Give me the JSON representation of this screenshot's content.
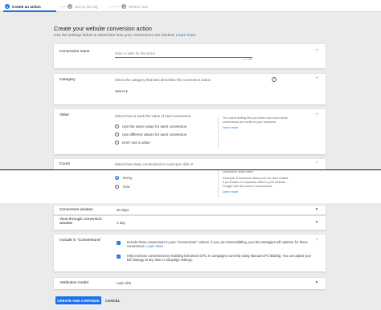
{
  "stepper": {
    "steps": [
      {
        "num": "1",
        "label": "Create an action"
      },
      {
        "num": "2",
        "label": "Set up the tag"
      },
      {
        "num": "3",
        "label": "What's next"
      }
    ]
  },
  "header": {
    "title": "Create your website conversion action",
    "subtitle": "Use the settings below to determine how your conversions are tracked.",
    "learn_more": "Learn more"
  },
  "conversion_name": {
    "label": "Conversion name",
    "placeholder": "Enter a name for this action",
    "counter": "0 / 100"
  },
  "category": {
    "label": "Category",
    "description": "Select the category that best describes this conversion action",
    "select_value": "Select"
  },
  "value": {
    "label": "Value",
    "prompt": "Select how to track the value of each conversion",
    "options": [
      "Use the same value for each conversion",
      "Use different values for each conversion",
      "Don't use a value"
    ],
    "help": "The value setting lets you track how much these conversions are worth to your business",
    "help_link": "Learn more"
  },
  "count": {
    "label": "Count",
    "prompt": "Select how many conversions to count per click or",
    "help_top": "conversion adds value.",
    "options": [
      "Every",
      "One"
    ],
    "help": "Example: If someone clicks your ad, then makes 2 purchases on separate visits to your website, Google Ads will count 2 conversions.",
    "help_link": "Learn more"
  },
  "conversion_window": {
    "label": "Conversion window",
    "value": "30 days"
  },
  "view_through": {
    "label": "View-through conversion window",
    "value": "1 day"
  },
  "include": {
    "label": "Include in \"Conversions\"",
    "option1": "Include these conversions in your \"Conversions\" column. If you use Smart Bidding, your bid strategies will optimize for these conversions.",
    "option1_link": "Learn more",
    "option2": "Help increase conversions by enabling Enhanced CPC in campaigns currently using Manual CPC bidding. You can adjust your bid strategy at any time in campaign settings."
  },
  "attribution": {
    "label": "Attribution model",
    "value": "Last click"
  },
  "actions": {
    "create": "CREATE AND CONTINUE",
    "cancel": "CANCEL"
  },
  "glyphs": {
    "chevron_up": "⌃",
    "chevron_down": "▾",
    "check": "✓",
    "info": "?"
  },
  "colors": {
    "primary": "#1a73e8",
    "page_bg": "#ebebeb",
    "card_bg": "#ffffff"
  }
}
